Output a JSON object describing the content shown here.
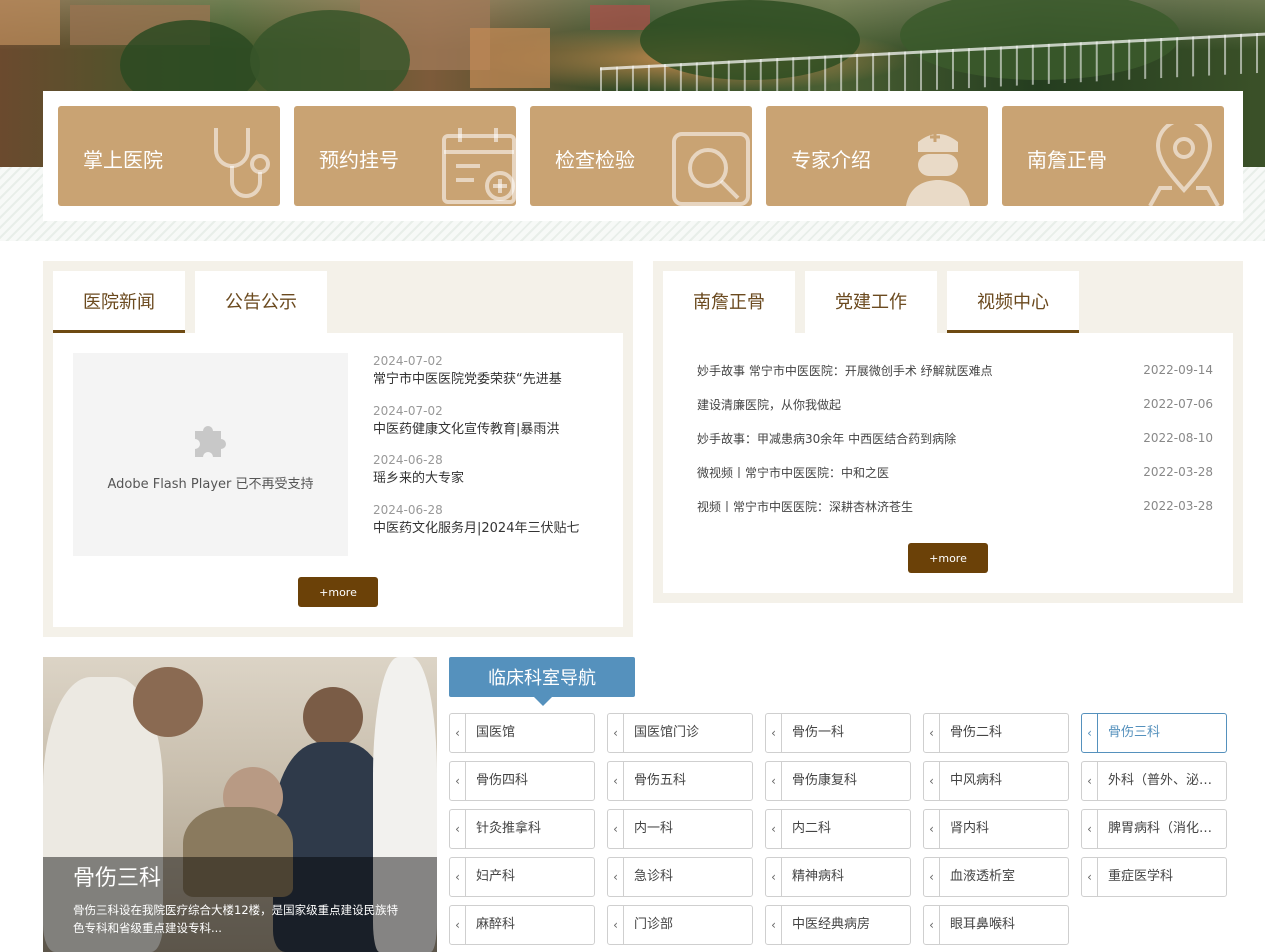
{
  "quick_links": [
    {
      "label": "掌上医院",
      "icon": "stethoscope-icon"
    },
    {
      "label": "预约挂号",
      "icon": "calendar-add-icon"
    },
    {
      "label": "检查检验",
      "icon": "magnifier-icon"
    },
    {
      "label": "专家介绍",
      "icon": "doctor-icon"
    },
    {
      "label": "南詹正骨",
      "icon": "location-pin-icon"
    }
  ],
  "news_panel": {
    "tabs": [
      {
        "label": "医院新闻",
        "active": true
      },
      {
        "label": "公告公示",
        "active": false
      }
    ],
    "flash_text": "Adobe Flash Player 已不再受支持",
    "items": [
      {
        "date": "2024-07-02",
        "title": "常宁市中医医院党委荣获“先进基"
      },
      {
        "date": "2024-07-02",
        "title": "中医药健康文化宣传教育|暴雨洪"
      },
      {
        "date": "2024-06-28",
        "title": "瑶乡来的大专家"
      },
      {
        "date": "2024-06-28",
        "title": "中医药文化服务月|2024年三伏贴七"
      }
    ],
    "more_label": "+more"
  },
  "video_panel": {
    "tabs": [
      {
        "label": "南詹正骨",
        "active": false
      },
      {
        "label": "党建工作",
        "active": false
      },
      {
        "label": "视频中心",
        "active": true
      }
    ],
    "items": [
      {
        "title": "妙手故事 常宁市中医医院：开展微创手术 纾解就医难点",
        "date": "2022-09-14"
      },
      {
        "title": "建设清廉医院，从你我做起",
        "date": "2022-07-06"
      },
      {
        "title": "妙手故事：甲减患病30余年 中西医结合药到病除",
        "date": "2022-08-10"
      },
      {
        "title": "微视频丨常宁市中医医院：中和之医",
        "date": "2022-03-28"
      },
      {
        "title": "视频丨常宁市中医医院：深耕杏林济苍生",
        "date": "2022-03-28"
      }
    ],
    "more_label": "+more"
  },
  "feature": {
    "title": "骨伤三科",
    "description": "骨伤三科设在我院医疗综合大楼12楼，是国家级重点建设民族特色专科和省级重点建设专科..."
  },
  "dept_nav": {
    "title": "临床科室导航",
    "selected": "骨伤三科",
    "items": [
      "国医馆",
      "国医馆门诊",
      "骨伤一科",
      "骨伤二科",
      "骨伤三科",
      "骨伤四科",
      "骨伤五科",
      "骨伤康复科",
      "中风病科",
      "外科（普外、泌尿外科）",
      "针灸推拿科",
      "内一科",
      "内二科",
      "肾内科",
      "脾胃病科（消化内科）",
      "妇产科",
      "急诊科",
      "精神病科",
      "血液透析室",
      "重症医学科",
      "麻醉科",
      "门诊部",
      "中医经典病房",
      "眼耳鼻喉科"
    ]
  },
  "colors": {
    "quick_tile": "#c9a373",
    "panel_bg": "#f4f1e9",
    "more_button": "#6b4108",
    "tab_text": "#6b4a1f",
    "nav_accent": "#5591bd"
  }
}
